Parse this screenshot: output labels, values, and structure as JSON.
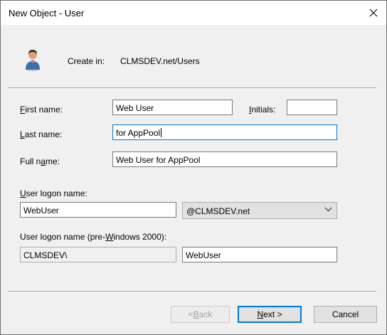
{
  "window": {
    "title": "New Object - User"
  },
  "header": {
    "create_in_label": "Create in:",
    "create_in_path": "CLMSDEV.net/Users"
  },
  "form": {
    "first_name": {
      "label": "First name:",
      "mnemonic": "F",
      "rest": "irst name:",
      "value": "Web User"
    },
    "initials": {
      "label": "Initials:",
      "mnemonic": "I",
      "rest": "nitials:",
      "value": ""
    },
    "last_name": {
      "label": "Last name:",
      "mnemonic": "L",
      "rest": "ast name:",
      "value": "for AppPool"
    },
    "full_name": {
      "label": "Full name:",
      "pre": "Full n",
      "mnemonic": "a",
      "rest": "me:",
      "value": "Web User for AppPool"
    },
    "logon_name": {
      "label": "User logon name:",
      "mnemonic": "U",
      "rest": "ser logon name:",
      "value": "WebUser",
      "domain_selected": "@CLMSDEV.net"
    },
    "pre2000": {
      "label": "User logon name (pre-Windows 2000):",
      "pre": "User logon name (pre-",
      "mnemonic": "W",
      "rest": "indows 2000):",
      "domain_prefix": "CLMSDEV\\",
      "value": "WebUser"
    }
  },
  "buttons": {
    "back": {
      "label": "< Back",
      "pre": "< ",
      "mnemonic": "B",
      "rest": "ack"
    },
    "next": {
      "label": "Next >",
      "mnemonic": "N",
      "rest": "ext >"
    },
    "cancel": {
      "label": "Cancel"
    }
  },
  "icons": {
    "close": "close-icon",
    "user": "user-icon",
    "dropdown": "chevron-down-icon"
  },
  "colors": {
    "focus_border": "#0078d7",
    "dialog_bg": "#f0f0f0",
    "avatar_shirt": "#3b6fb0"
  }
}
